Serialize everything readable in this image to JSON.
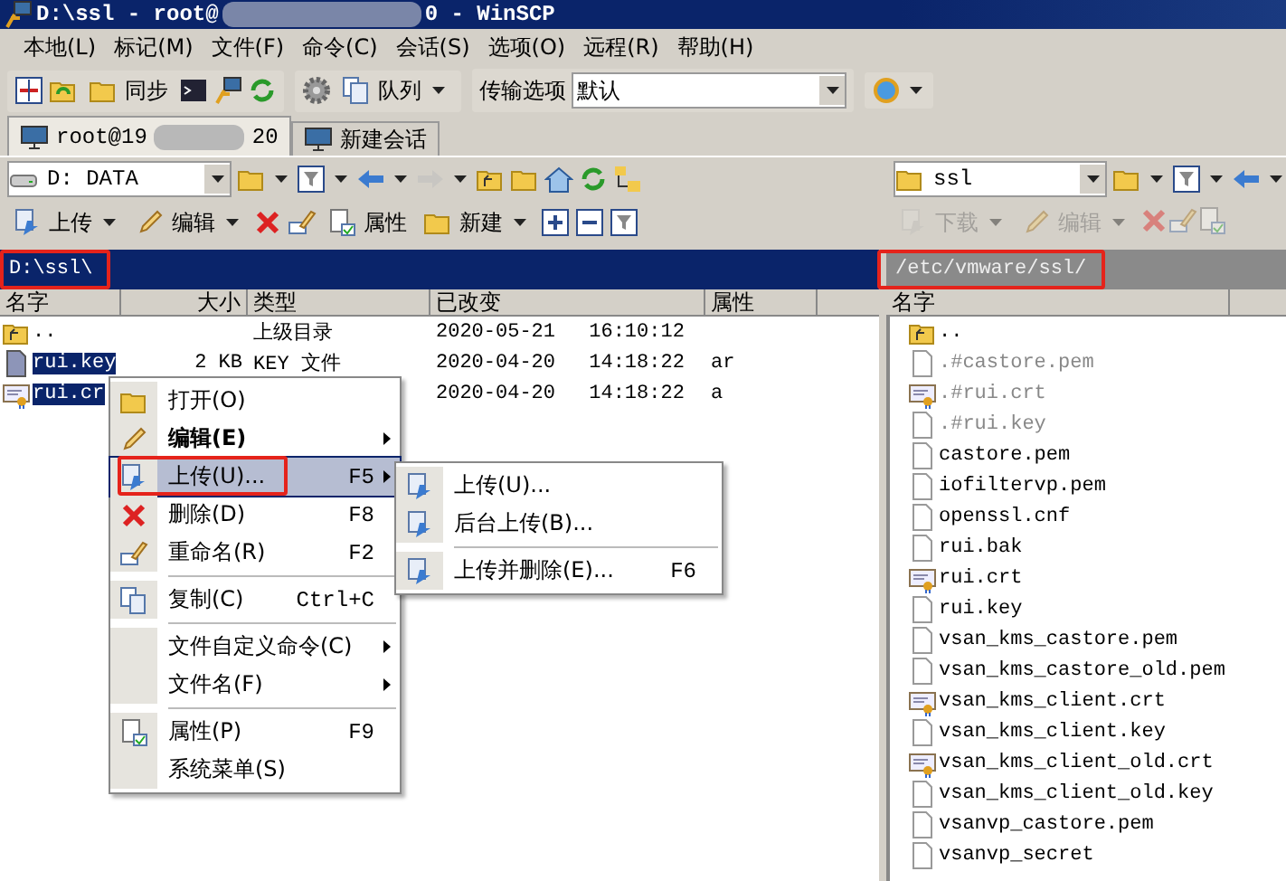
{
  "window": {
    "title": "D:\\ssl - root@",
    "title_tail": "0 - WinSCP"
  },
  "menu": [
    "本地(L)",
    "标记(M)",
    "文件(F)",
    "命令(C)",
    "会话(S)",
    "选项(O)",
    "远程(R)",
    "帮助(H)"
  ],
  "toolbar": {
    "sync": "同步",
    "queue": "队列",
    "transfer_label": "传输选项",
    "transfer_value": "默认"
  },
  "tabs": [
    {
      "label": "root@19",
      "tail": "20",
      "selected": true
    },
    {
      "label": "新建会话",
      "selected": false
    }
  ],
  "left_panel": {
    "drive": "D: DATA",
    "path": "D:\\ssl\\",
    "active": true,
    "buttons": [
      {
        "label": "上传",
        "disabled": false
      },
      {
        "label": "编辑",
        "disabled": false
      },
      {
        "label": "属性",
        "disabled": false
      },
      {
        "label": "新建",
        "disabled": false
      }
    ],
    "columns": [
      "名字",
      "大小",
      "类型",
      "已改变",
      "属性"
    ],
    "rows": [
      {
        "kind": "up",
        "name": "..",
        "type": "上级目录",
        "changed": "2020-05-21 16:10:12",
        "selected": false
      },
      {
        "kind": "key",
        "name": "rui.key",
        "size": "2 KB",
        "type": "KEY 文件",
        "changed": "2020-04-20 14:18:22",
        "attr": "ar",
        "selected": true
      },
      {
        "kind": "cert",
        "name": "rui.cr",
        "changed": "2020-04-20 14:18:22",
        "attr": "a",
        "selected": true
      }
    ]
  },
  "right_panel": {
    "drive": "ssl",
    "path": "/etc/vmware/ssl/",
    "active": false,
    "buttons": [
      {
        "label": "下载",
        "disabled": true
      },
      {
        "label": "编辑",
        "disabled": true
      }
    ],
    "columns": [
      "名字"
    ],
    "rows": [
      {
        "kind": "up",
        "name": "..",
        "hidden": false
      },
      {
        "kind": "file",
        "name": ".#castore.pem",
        "hidden": true
      },
      {
        "kind": "cert",
        "name": ".#rui.crt",
        "hidden": true
      },
      {
        "kind": "file",
        "name": ".#rui.key",
        "hidden": true
      },
      {
        "kind": "file",
        "name": "castore.pem",
        "hidden": false
      },
      {
        "kind": "file",
        "name": "iofiltervp.pem",
        "hidden": false
      },
      {
        "kind": "file",
        "name": "openssl.cnf",
        "hidden": false
      },
      {
        "kind": "file",
        "name": "rui.bak",
        "hidden": false
      },
      {
        "kind": "cert",
        "name": "rui.crt",
        "hidden": false
      },
      {
        "kind": "file",
        "name": "rui.key",
        "hidden": false
      },
      {
        "kind": "file",
        "name": "vsan_kms_castore.pem",
        "hidden": false
      },
      {
        "kind": "file",
        "name": "vsan_kms_castore_old.pem",
        "hidden": false
      },
      {
        "kind": "cert",
        "name": "vsan_kms_client.crt",
        "hidden": false
      },
      {
        "kind": "file",
        "name": "vsan_kms_client.key",
        "hidden": false
      },
      {
        "kind": "cert",
        "name": "vsan_kms_client_old.crt",
        "hidden": false
      },
      {
        "kind": "file",
        "name": "vsan_kms_client_old.key",
        "hidden": false
      },
      {
        "kind": "file",
        "name": "vsanvp_castore.pem",
        "hidden": false
      },
      {
        "kind": "file",
        "name": "vsanvp_secret",
        "hidden": false
      }
    ]
  },
  "context_menu": [
    {
      "label": "打开(O)",
      "bold": false,
      "submenu": false,
      "selected": false,
      "separator_after": false
    },
    {
      "label": "编辑(E)",
      "bold": true,
      "submenu": true,
      "selected": false,
      "separator_after": false
    },
    {
      "label": "上传(U)...",
      "shortcut": "F5",
      "bold": false,
      "submenu": true,
      "selected": true,
      "separator_after": false
    },
    {
      "label": "删除(D)",
      "shortcut": "F8",
      "bold": false,
      "submenu": false,
      "selected": false,
      "separator_after": false
    },
    {
      "label": "重命名(R)",
      "shortcut": "F2",
      "bold": false,
      "submenu": false,
      "selected": false,
      "separator_after": true
    },
    {
      "label": "复制(C)",
      "shortcut": "Ctrl+C",
      "bold": false,
      "submenu": false,
      "selected": false,
      "separator_after": true
    },
    {
      "label": "文件自定义命令(C)",
      "bold": false,
      "submenu": true,
      "selected": false,
      "separator_after": false
    },
    {
      "label": "文件名(F)",
      "bold": false,
      "submenu": true,
      "selected": false,
      "separator_after": true
    },
    {
      "label": "属性(P)",
      "shortcut": "F9",
      "bold": false,
      "submenu": false,
      "selected": false,
      "separator_after": false
    },
    {
      "label": "系统菜单(S)",
      "bold": false,
      "submenu": false,
      "selected": false,
      "separator_after": false
    }
  ],
  "submenu": [
    {
      "label": "上传(U)...",
      "separator_after": false
    },
    {
      "label": "后台上传(B)...",
      "separator_after": true
    },
    {
      "label": "上传并删除(E)...",
      "shortcut": "F6",
      "separator_after": false
    }
  ]
}
